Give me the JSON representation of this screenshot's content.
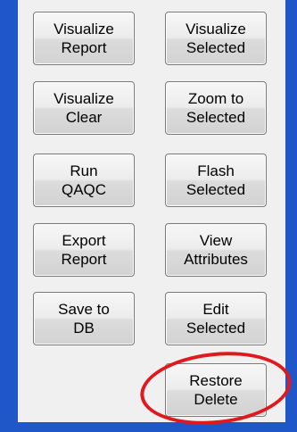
{
  "buttons": {
    "visualize_report": [
      "Visualize",
      "Report"
    ],
    "visualize_selected": [
      "Visualize",
      "Selected"
    ],
    "visualize_clear": [
      "Visualize",
      "Clear"
    ],
    "zoom_to_selected": [
      "Zoom to",
      "Selected"
    ],
    "run_qaqc": [
      "Run",
      "QAQC"
    ],
    "flash_selected": [
      "Flash",
      "Selected"
    ],
    "export_report": [
      "Export",
      "Report"
    ],
    "view_attributes": [
      "View",
      "Attributes"
    ],
    "save_to_db": [
      "Save to",
      "DB"
    ],
    "edit_selected": [
      "Edit",
      "Selected"
    ],
    "restore_delete": [
      "Restore",
      "Delete"
    ]
  },
  "colors": {
    "background": "#1f57c8",
    "panel": "#f0f0f0",
    "highlight": "#e0191f"
  }
}
